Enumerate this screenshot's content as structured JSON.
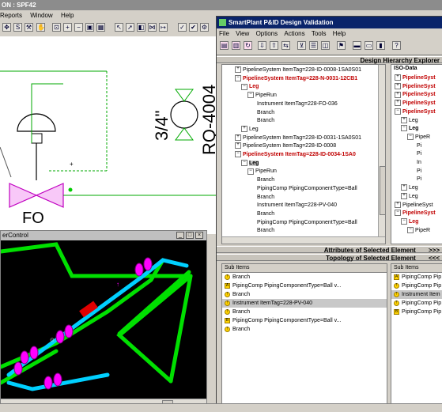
{
  "background_app": {
    "title": "ON : SPF42",
    "menu": [
      "Reports",
      "Window",
      "Help"
    ],
    "drawing": {
      "valve_label": "FO",
      "fraction_label": "3/4\"",
      "vertical_text": "RQ-4004"
    }
  },
  "vessel_window": {
    "title": "erControl"
  },
  "main_window": {
    "title": "SmartPlant P&ID Design Validation",
    "menu": [
      "File",
      "View",
      "Options",
      "Actions",
      "Tools",
      "Help"
    ],
    "explorer_header": "Design Hierarchy Explorer",
    "attributes_header": "Attributes of Selected Element",
    "attributes_arrows": ">>>",
    "topology_header": "Topology of Selected Element",
    "topology_arrows": "<<<",
    "left_tree": [
      {
        "text": "PipelineSystem ItemTag=228-ID-0008-1SA0S01",
        "level": 0,
        "exp": "+",
        "red": false
      },
      {
        "text": "PipelineSystem ItemTag=228-N-0031-12CB1",
        "level": 0,
        "exp": "−",
        "red": true
      },
      {
        "text": "Leg",
        "level": 1,
        "exp": "−",
        "red": true
      },
      {
        "text": "PipeRun",
        "level": 2,
        "exp": "−",
        "red": false
      },
      {
        "text": "Instrument ItemTag=228-FO-036",
        "level": 3,
        "exp": "",
        "red": false
      },
      {
        "text": "Branch",
        "level": 3,
        "exp": "",
        "red": false
      },
      {
        "text": "Branch",
        "level": 3,
        "exp": "",
        "red": false
      },
      {
        "text": "Leg",
        "level": 1,
        "exp": "+",
        "red": false
      },
      {
        "text": "PipelineSystem ItemTag=228-ID-0031-1SA0S01",
        "level": 0,
        "exp": "+",
        "red": false
      },
      {
        "text": "PipelineSystem ItemTag=228-ID-0008",
        "level": 0,
        "exp": "+",
        "red": false
      },
      {
        "text": "PipelineSystem ItemTag=228-ID-0034-1SA0",
        "level": 0,
        "exp": "−",
        "red": true
      },
      {
        "text": "Leg",
        "level": 1,
        "exp": "−",
        "red": false,
        "selected": true
      },
      {
        "text": "PipeRun",
        "level": 2,
        "exp": "−",
        "red": false
      },
      {
        "text": "Branch",
        "level": 3,
        "exp": "",
        "red": false
      },
      {
        "text": "PipingComp PipingComponentType=Ball",
        "level": 3,
        "exp": "",
        "red": false
      },
      {
        "text": "Branch",
        "level": 3,
        "exp": "",
        "red": false
      },
      {
        "text": "Instrument ItemTag=228-PV-040",
        "level": 3,
        "exp": "",
        "red": false
      },
      {
        "text": "Branch",
        "level": 3,
        "exp": "",
        "red": false
      },
      {
        "text": "PipingComp PipingComponentType=Ball",
        "level": 3,
        "exp": "",
        "red": false
      },
      {
        "text": "Branch",
        "level": 3,
        "exp": "",
        "red": false
      }
    ],
    "right_tree_header": "ISO-Data",
    "right_tree": [
      {
        "text": "PipelineSyst",
        "level": 0,
        "exp": "+",
        "red": true
      },
      {
        "text": "PipelineSyst",
        "level": 0,
        "exp": "+",
        "red": true
      },
      {
        "text": "PipelineSyst",
        "level": 0,
        "exp": "+",
        "red": true
      },
      {
        "text": "PipelineSyst",
        "level": 0,
        "exp": "+",
        "red": true
      },
      {
        "text": "PipelineSyst",
        "level": 0,
        "exp": "−",
        "red": true
      },
      {
        "text": "Leg",
        "level": 1,
        "exp": "+",
        "red": false
      },
      {
        "text": "Leg",
        "level": 1,
        "exp": "−",
        "red": false,
        "bold": true
      },
      {
        "text": "PipeR",
        "level": 2,
        "exp": "−",
        "red": false
      },
      {
        "text": "Pi",
        "level": 3,
        "exp": "",
        "red": false
      },
      {
        "text": "Pi",
        "level": 3,
        "exp": "",
        "red": false
      },
      {
        "text": "In",
        "level": 3,
        "exp": "",
        "red": false
      },
      {
        "text": "Pi",
        "level": 3,
        "exp": "",
        "red": false
      },
      {
        "text": "Pi",
        "level": 3,
        "exp": "",
        "red": false
      },
      {
        "text": "Leg",
        "level": 1,
        "exp": "+",
        "red": false
      },
      {
        "text": "Leg",
        "level": 1,
        "exp": "+",
        "red": false
      },
      {
        "text": "PipelineSyst",
        "level": 0,
        "exp": "+",
        "red": false
      },
      {
        "text": "PipelineSyst",
        "level": 0,
        "exp": "−",
        "red": true
      },
      {
        "text": "Leg",
        "level": 1,
        "exp": "−",
        "red": true
      },
      {
        "text": "PipeR",
        "level": 2,
        "exp": "−",
        "red": false
      }
    ],
    "subitems_header": "Sub Items",
    "subitems_left": [
      {
        "text": "Branch",
        "icon": "!"
      },
      {
        "text": "PipingComp PipingComponentType=Ball v...",
        "icon": "A"
      },
      {
        "text": "Branch",
        "icon": "!"
      },
      {
        "text": "Instrument ItemTag=228-PV-040",
        "icon": "!",
        "selected": true
      },
      {
        "text": "Branch",
        "icon": "!"
      },
      {
        "text": "PipingComp PipingComponentType=Ball v...",
        "icon": "B"
      },
      {
        "text": "Branch",
        "icon": "!"
      }
    ],
    "subitems_right": [
      {
        "text": "PipingComp Pip",
        "icon": "A"
      },
      {
        "text": "PipingComp Pip",
        "icon": "!"
      },
      {
        "text": "Instrument Item",
        "icon": "!",
        "selected": true
      },
      {
        "text": "PipingComp Pip",
        "icon": "!"
      },
      {
        "text": "PipingComp Pip",
        "icon": "B"
      }
    ]
  },
  "colors": {
    "tree_red": "#c00000",
    "title_blue": "#0a246a",
    "pipe_green": "#00e000",
    "pipe_cyan": "#00e0ff",
    "flange_magenta": "#ff00ff"
  }
}
